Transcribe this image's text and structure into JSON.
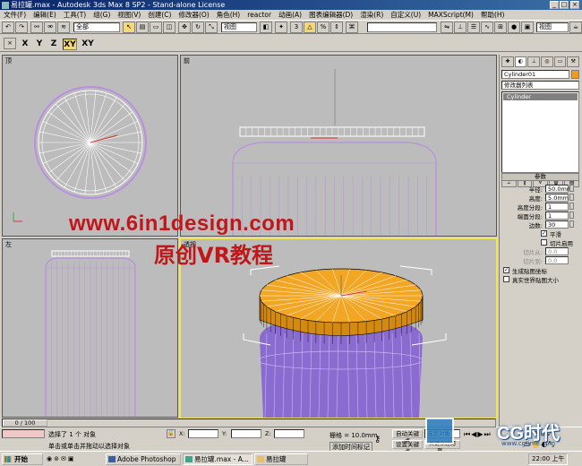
{
  "window": {
    "title": "易拉罐.max - Autodesk 3ds Max 8 SP2 - Stand-alone License"
  },
  "menu": [
    "文件(F)",
    "编辑(E)",
    "工具(T)",
    "组(G)",
    "视图(V)",
    "创建(C)",
    "修改器(O)",
    "角色(H)",
    "reactor",
    "动画(A)",
    "图表编辑器(D)",
    "渲染(R)",
    "自定义(U)",
    "MAXScript(M)",
    "帮助(H)"
  ],
  "toolbar": {
    "selection_filter": "全部",
    "ref_coord": "视图",
    "axis_buttons": [
      "X",
      "Y",
      "Z",
      "XY",
      "XY"
    ]
  },
  "viewports": {
    "top": "顶",
    "front": "前",
    "left": "左",
    "perspective": "透视"
  },
  "watermark": {
    "url": "www.6in1design.com",
    "subtitle": "原创VR教程"
  },
  "command_panel": {
    "object_name": "Cylinder01",
    "modifier_list": "修改器列表",
    "stack_item": "Cylinder",
    "rollout_title": "参数",
    "params": [
      {
        "label": "半径:",
        "value": "50.0mm"
      },
      {
        "label": "高度:",
        "value": "5.0mm"
      },
      {
        "label": "高度分段:",
        "value": "1"
      },
      {
        "label": "端面分段:",
        "value": "1"
      },
      {
        "label": "边数:",
        "value": "30"
      }
    ],
    "checkboxes": {
      "smooth": "平滑",
      "slice_on": "切片启用",
      "slice_from": "切片从:",
      "slice_from_val": "0.0",
      "slice_to": "切片到:",
      "slice_to_val": "0.0",
      "gen_map": "生成贴图坐标",
      "real_world": "真实世界贴图大小"
    }
  },
  "status": {
    "timeline": "0 / 100",
    "selected": "选择了 1 个 对象",
    "prompt": "单击或单击并拖动以选择对象",
    "grid": "栅格 = 10.0mm",
    "add_time_tag": "添加时间标记",
    "auto_key": "自动关键点",
    "set_key": "设置关键点",
    "selected_dropdown": "选定对象",
    "key_filters": "关键点过滤器..."
  },
  "taskbar": {
    "start": "开始",
    "tasks": [
      "Adobe Photoshop",
      "易拉罐.max - A...",
      "易拉罐"
    ],
    "clock": "22:00 上午"
  },
  "logo": {
    "text": "CG时代",
    "sub": "www.cgtime.com"
  },
  "colors": {
    "title_bar": "#0a246a",
    "viewport_bg": "#bcbcbc",
    "active_border": "#f3e64d",
    "wire_purple": "#b98fe0",
    "lid_orange": "#f3a623",
    "can_purple": "#8a6cd0",
    "watermark_red": "#c0181a"
  }
}
